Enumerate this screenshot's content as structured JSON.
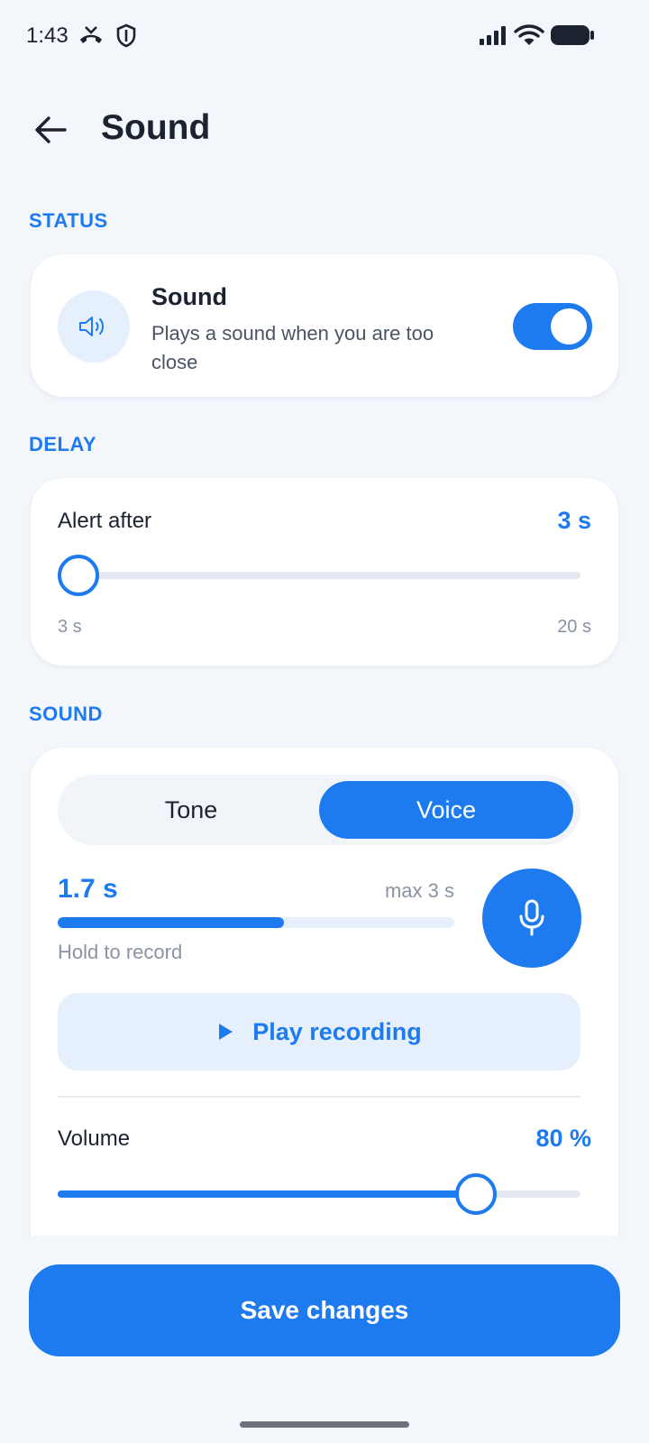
{
  "status_bar": {
    "time": "1:43"
  },
  "header": {
    "title": "Sound"
  },
  "sections": {
    "status": "STATUS",
    "delay": "DELAY",
    "sound": "SOUND"
  },
  "status_card": {
    "title": "Sound",
    "description": "Plays a sound when you are too close",
    "toggle_on": true
  },
  "delay_card": {
    "label": "Alert after",
    "value": "3 s",
    "min_label": "3 s",
    "max_label": "20 s",
    "slider_fraction": 0
  },
  "sound_card": {
    "tabs": [
      "Tone",
      "Voice"
    ],
    "selected_tab": "Voice",
    "recording_time": "1.7 s",
    "recording_max": "max 3 s",
    "recording_progress": 0.57,
    "recording_hint": "Hold to record",
    "play_label": "Play recording",
    "volume_label": "Volume",
    "volume_value": "80 %",
    "volume_fraction": 0.8
  },
  "footer": {
    "save_label": "Save changes"
  },
  "colors": {
    "accent": "#1E7BEF",
    "background": "#F3F6FB"
  }
}
